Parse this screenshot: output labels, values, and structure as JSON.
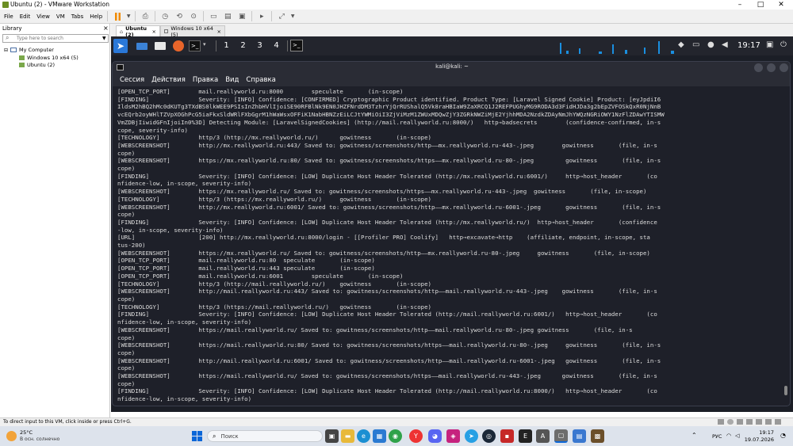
{
  "window": {
    "title": "Ubuntu (2) - VMware Workstation"
  },
  "menubar": {
    "items": [
      "File",
      "Edit",
      "View",
      "VM",
      "Tabs",
      "Help"
    ]
  },
  "library": {
    "title": "Library",
    "search_placeholder": "Type here to search",
    "tree": {
      "root": "My Computer",
      "children": [
        "Windows 10 x64 (5)",
        "Ubuntu (2)"
      ]
    }
  },
  "vm_tabs": [
    {
      "label": "Ubuntu (2)",
      "active": true
    },
    {
      "label": "Windows 10 x64 (5)",
      "active": false
    }
  ],
  "kali_panel": {
    "workspaces": [
      "1",
      "2",
      "3",
      "4"
    ],
    "clock": "19:17"
  },
  "terminal": {
    "title": "kali@kali: ~",
    "menu": [
      "Сессия",
      "Действия",
      "Правка",
      "Вид",
      "Справка"
    ],
    "lines": [
      "[OPEN_TCP_PORT]        mail.reallyworld.ru:8000        speculate       (in-scope)",
      "[FINDING]              Severity: [INFO] Confidence: [CONFIRMED] Cryptographic Product identified. Product Type: [Laravel Signed Cookie] Product: [eyJpdiI6",
      "IldsM2hBQ2hMc0dKUTg3TXdBS0lkWEE9PSIsInZhbHVlIjoiSE90RFBlNk9EN0JHZFNrdDM3TzhrYjQrRUShalQ5Vk8raHBIaW9ZaXRCQ1J2REFPUGhyMG9RODA3d3FidHJDa3g2bEpZVFOSkQxR0NjNnB",
      "vcEQrb2oyWHlTZVpXOGhPcG5iaFkxSldWRlFXbGgrM1hWaWsxOFFiK1NabHBNZzEiLCJtYWMiOiI3ZjViMzM1ZWUxMDQwZjY3ZGRkNWZiMjE2YjhhMDA2NzdkZDAyNmJhYWQzNGRiOWY1NzFlZDAwYTISMW",
      "VmZDBjIiwidGFnIjoiIn0%3D] Detecting Module: [LaravelSignedCookies] (http://mail.reallyworld.ru:8000/)   http→badsecrets        (confidence-confirmed, in-s",
      "cope, severity-info)",
      "[TECHNOLOGY]           http/3 (http://mx.reallyworld.ru/)      gowitness       (in-scope)",
      "[WEBSCREENSHOT]        http://mx.reallyworld.ru:443/ Saved to: gowitness/screenshots/http——mx.reallyworld.ru-443-.jpeg        gowitness       (file, in-s",
      "cope)",
      "[WEBSCREENSHOT]        https://mx.reallyworld.ru:80/ Saved to: gowitness/screenshots/https——mx.reallyworld.ru-80-.jpeg         gowitness       (file, in-s",
      "cope)",
      "[FINDING]              Severity: [INFO] Confidence: [LOW] Duplicate Host Header Tolerated (http://mx.reallyworld.ru:6001/)     http→host_header       (co",
      "nfidence-low, in-scope, severity-info)",
      "[WEBSCREENSHOT]        https://mx.reallyworld.ru/ Saved to: gowitness/screenshots/https——mx.reallyworld.ru-443-.jpeg  gowitness       (file, in-scope)",
      "[TECHNOLOGY]           http/3 (https://mx.reallyworld.ru/)     gowitness       (in-scope)",
      "[WEBSCREENSHOT]        http://mx.reallyworld.ru:6001/ Saved to: gowitness/screenshots/http——mx.reallyworld.ru-6001-.jpeg       gowitness       (file, in-s",
      "cope)",
      "[FINDING]              Severity: [INFO] Confidence: [LOW] Duplicate Host Header Tolerated (http://mx.reallyworld.ru/)  http→host_header       (confidence",
      "-low, in-scope, severity-info)",
      "[URL]                  [200] http://mx.reallyworld.ru:8000/login - [[Profiler PRO] Coolify]   http→excavate→http    (affiliate, endpoint, in-scope, sta",
      "tus-200)",
      "[WEBSCREENSHOT]        https://mx.reallyworld.ru/ Saved to: gowitness/screenshots/http——mx.reallyworld.ru-80-.jpeg     gowitness       (file, in-scope)",
      "[OPEN_TCP_PORT]        mail.reallyworld.ru:80  speculate       (in-scope)",
      "[OPEN_TCP_PORT]        mail.reallyworld.ru:443 speculate       (in-scope)",
      "[OPEN_TCP_PORT]        mail.reallyworld.ru:6001        speculate       (in-scope)",
      "[TECHNOLOGY]           http/3 (http://mail.reallyworld.ru/)    gowitness       (in-scope)",
      "[WEBSCREENSHOT]        http://mail.reallyworld.ru:443/ Saved to: gowitness/screenshots/http——mail.reallyworld.ru-443-.jpeg    gowitness       (file, in-s",
      "cope)",
      "[TECHNOLOGY]           http/3 (https://mail.reallyworld.ru/)   gowitness       (in-scope)",
      "[FINDING]              Severity: [INFO] Confidence: [LOW] Duplicate Host Header Tolerated (http://mail.reallyworld.ru:6001/)   http→host_header       (co",
      "nfidence-low, in-scope, severity-info)",
      "[WEBSCREENSHOT]        https://mail.reallyworld.ru/ Saved to: gowitness/screenshots/http——mail.reallyworld.ru-80-.jpeg gowitness       (file, in-s",
      "cope)",
      "[WEBSCREENSHOT]        https://mail.reallyworld.ru:80/ Saved to: gowitness/screenshots/https——mail.reallyworld.ru-80-.jpeg     gowitness       (file, in-s",
      "cope)",
      "[WEBSCREENSHOT]        http://mail.reallyworld.ru:6001/ Saved to: gowitness/screenshots/http——mail.reallyworld.ru-6001-.jpeg   gowitness       (file, in-s",
      "cope)",
      "[WEBSCREENSHOT]        https://mail.reallyworld.ru/ Saved to: gowitness/screenshots/https——mail.reallyworld.ru-443-.jpeg      gowitness       (file, in-s",
      "cope)",
      "[FINDING]              Severity: [INFO] Confidence: [LOW] Duplicate Host Header Tolerated (http://mail.reallyworld.ru:8000/)   http→host_header       (co",
      "nfidence-low, in-scope, severity-info)"
    ]
  },
  "statusbar": {
    "text": "To direct input to this VM, click inside or press Ctrl+G."
  },
  "taskbar": {
    "weather_temp": "25°C",
    "weather_desc": "В осн. солнечно",
    "search_label": "Поиск",
    "lang": "РУС",
    "time": "19:17",
    "date": "19.07.2026"
  },
  "colors": {
    "terminal_bg": "#1e2029",
    "kali_panel": "#23252d",
    "accent_blue": "#1e6bd6"
  }
}
